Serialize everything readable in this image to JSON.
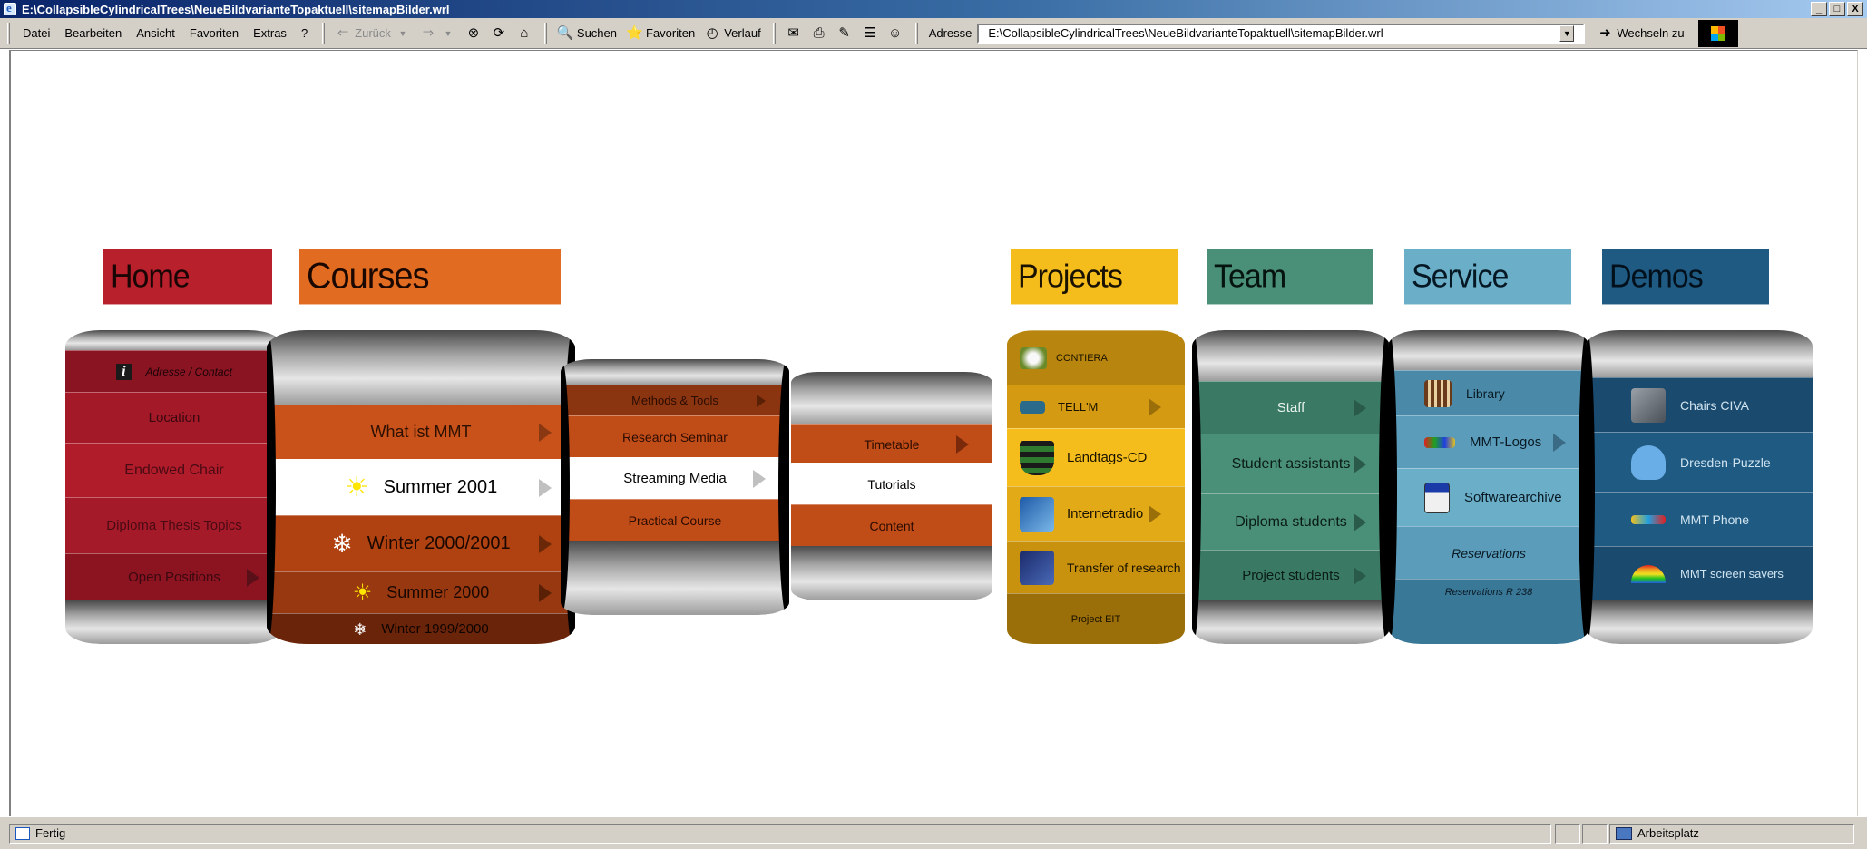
{
  "window": {
    "title": "E:\\CollapsibleCylindricalTrees\\NeueBildvarianteTopaktuell\\sitemapBilder.wrl",
    "buttons": [
      "_",
      "□",
      "X"
    ]
  },
  "menu": {
    "items": [
      {
        "label": "Datei"
      },
      {
        "label": "Bearbeiten"
      },
      {
        "label": "Ansicht"
      },
      {
        "label": "Favoriten"
      },
      {
        "label": "Extras"
      },
      {
        "label": "?"
      }
    ]
  },
  "toolbar": {
    "back_label": "Zurück",
    "search_label": "Suchen",
    "favorites_label": "Favoriten",
    "history_label": "Verlauf"
  },
  "address": {
    "label": "Adresse",
    "value": "E:\\CollapsibleCylindricalTrees\\NeueBildvarianteTopaktuell\\sitemapBilder.wrl",
    "go_label": "Wechseln zu"
  },
  "status": {
    "text": "Fertig",
    "zone": "Arbeitsplatz"
  },
  "sitemap": {
    "headers": {
      "home": "Home",
      "courses": "Courses",
      "projects": "Projects",
      "team": "Team",
      "service": "Service",
      "demos": "Demos"
    },
    "home": [
      "Adresse / Contact",
      "Location",
      "Endowed Chair",
      "Diploma Thesis Topics",
      "Open Positions"
    ],
    "courses": [
      "What ist MMT",
      "Summer 2001",
      "Winter 2000/2001",
      "Summer 2000",
      "Winter 1999/2000"
    ],
    "courses_sub": [
      "Methods & Tools",
      "Research Seminar",
      "Streaming Media",
      "Practical Course"
    ],
    "courses_sub2": [
      "Timetable",
      "Tutorials",
      "Content"
    ],
    "projects": [
      "CONTIERA",
      "TELL'M",
      "Landtags-CD",
      "Internetradio",
      "Transfer of research",
      "Project EIT"
    ],
    "team": [
      "Staff",
      "Student assistants",
      "Diploma students",
      "Project students"
    ],
    "service": [
      "Library",
      "MMT-Logos",
      "Softwarearchive",
      "Reservations",
      "Reservations R 238"
    ],
    "demos": [
      "Chairs CIVA",
      "Dresden-Puzzle",
      "MMT Phone",
      "MMT screen savers"
    ]
  },
  "colors": {
    "home": "#b8202c",
    "courses": "#e26b22",
    "projects": "#f5bd1c",
    "team": "#4a8f78",
    "service": "#6aaec8",
    "demos": "#1f5a82"
  }
}
